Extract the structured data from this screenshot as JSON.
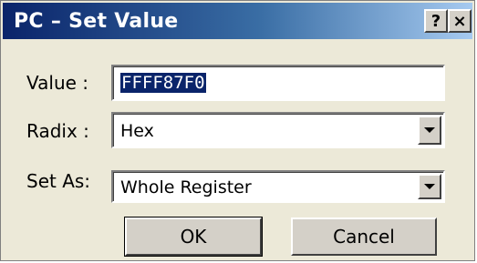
{
  "dialog": {
    "title": "PC – Set Value",
    "help_button": "?",
    "close_button": "×"
  },
  "fields": {
    "value_label": "Value :",
    "value": "FFFF87F0",
    "radix_label": "Radix :",
    "radix_selected": "Hex",
    "setas_label": "Set As:",
    "setas_selected": "Whole Register"
  },
  "buttons": {
    "ok": "OK",
    "cancel": "Cancel"
  },
  "colors": {
    "titlebar_start": "#0a246a",
    "titlebar_end": "#a6caf0",
    "dialog_bg": "#ece9d8",
    "selection": "#0a246a"
  },
  "icons": {
    "dropdown": "chevron-down-icon"
  }
}
